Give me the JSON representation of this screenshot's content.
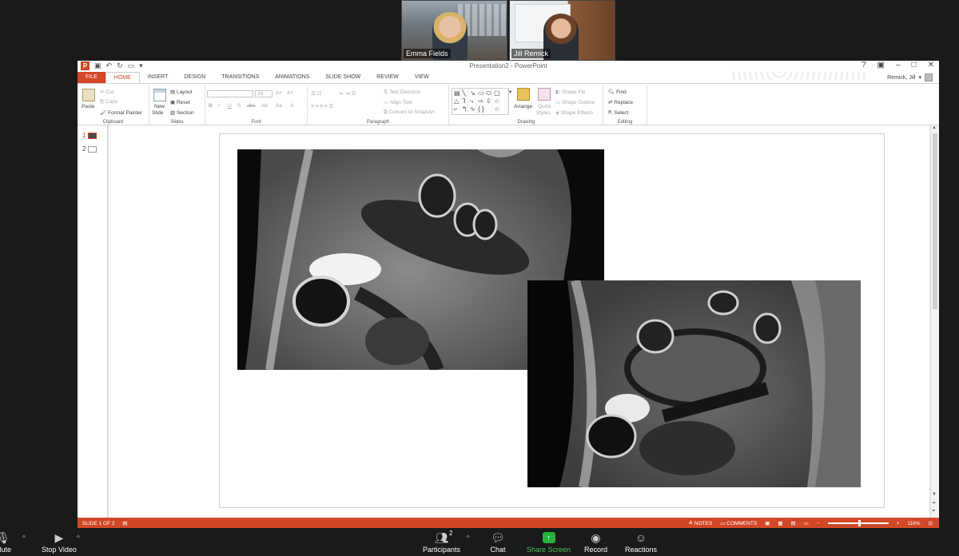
{
  "meeting": {
    "participants": [
      {
        "name": "Emma Fields"
      },
      {
        "name": "Jill Remick"
      }
    ]
  },
  "powerpoint": {
    "window_title": "Presentation2 - PowerPoint",
    "file_tab": "FILE",
    "tabs": [
      "HOME",
      "INSERT",
      "DESIGN",
      "TRANSITIONS",
      "ANIMATIONS",
      "SLIDE SHOW",
      "REVIEW",
      "VIEW"
    ],
    "active_tab": "HOME",
    "user_name": "Remick, Jill",
    "ribbon": {
      "clipboard": {
        "label": "Clipboard",
        "paste": "Paste",
        "cut": "Cut",
        "copy": "Copy",
        "format_painter": "Format Painter"
      },
      "slides": {
        "label": "Slides",
        "new_slide": "New",
        "new_slide_2": "Slide",
        "layout": "Layout",
        "reset": "Reset",
        "section": "Section"
      },
      "font": {
        "label": "Font",
        "size": "24",
        "bold": "B",
        "italic": "I",
        "underline": "U",
        "strike": "S",
        "shadow": "abc",
        "spacing": "AV",
        "case": "Aa",
        "color": "A"
      },
      "paragraph": {
        "label": "Paragraph",
        "text_direction": "Text Direction",
        "align_text": "Align Text",
        "convert_smartart": "Convert to SmartArt"
      },
      "drawing": {
        "label": "Drawing",
        "arrange": "Arrange",
        "quick_styles": "Quick",
        "quick_styles_2": "Styles",
        "shape_fill": "Shape Fill",
        "shape_outline": "Shape Outline",
        "shape_effects": "Shape Effects"
      },
      "editing": {
        "label": "Editing",
        "find": "Find",
        "replace": "Replace",
        "select": "Select"
      }
    },
    "thumbnails": [
      {
        "number": "1",
        "selected": true
      },
      {
        "number": "2",
        "selected": false
      }
    ],
    "status": {
      "slide_info": "SLIDE 1 OF 2",
      "notes": "NOTES",
      "comments": "COMMENTS",
      "zoom": "116%"
    }
  },
  "toolbar": {
    "mute": "Mute",
    "stop_video": "Stop Video",
    "participants": "Participants",
    "participants_count": "2",
    "chat": "Chat",
    "share_screen": "Share Screen",
    "record": "Record",
    "reactions": "Reactions"
  },
  "colors": {
    "ppt_accent": "#d24726",
    "share_green": "#25b23a",
    "zoom_bg": "#1a1a1a"
  }
}
